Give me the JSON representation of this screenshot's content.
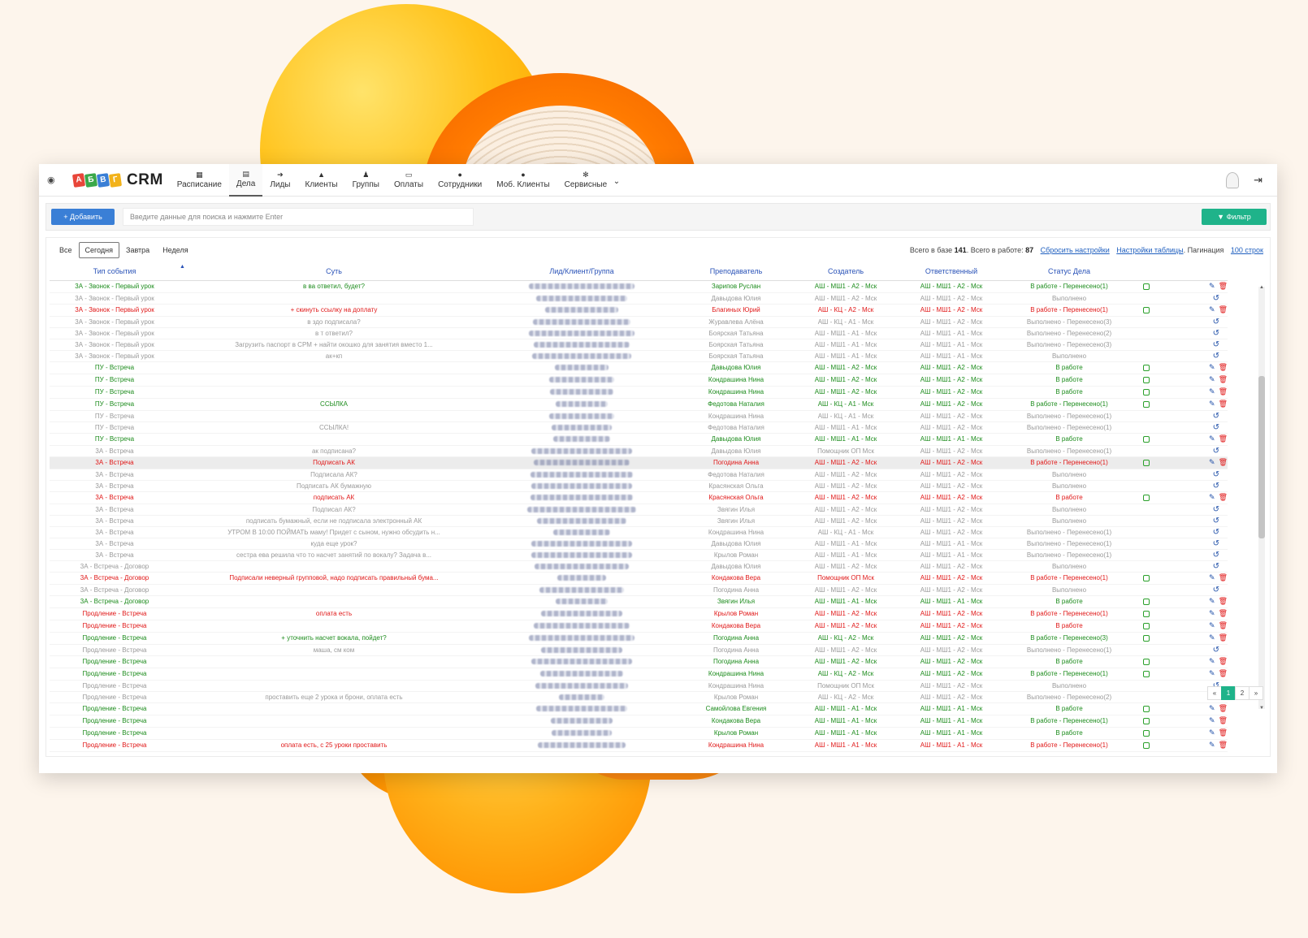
{
  "logo": {
    "text": "CRM"
  },
  "nav": [
    {
      "icon": "calendar-icon",
      "glyph": "▦",
      "label": "Расписание"
    },
    {
      "icon": "calendar-check-icon",
      "glyph": "▤",
      "label": "Дела",
      "active": true
    },
    {
      "icon": "sign-in-icon",
      "glyph": "➔",
      "label": "Лиды"
    },
    {
      "icon": "graduation-cap-icon",
      "glyph": "▲",
      "label": "Клиенты"
    },
    {
      "icon": "users-icon",
      "glyph": "♟",
      "label": "Группы"
    },
    {
      "icon": "credit-card-icon",
      "glyph": "▭",
      "label": "Оплаты"
    },
    {
      "icon": "user-icon",
      "glyph": "●",
      "label": "Сотрудники"
    },
    {
      "icon": "user-icon",
      "glyph": "●",
      "label": "Моб. Клиенты"
    },
    {
      "icon": "gear-icon",
      "glyph": "✻",
      "label": "Сервисные"
    }
  ],
  "toolbar": {
    "add_label": "+ Добавить",
    "search_placeholder": "Введите данные для поиска и нажмите Enter",
    "filter_label": "▼ Фильтр"
  },
  "tabs": [
    "Все",
    "Сегодня",
    "Завтра",
    "Неделя"
  ],
  "stats": {
    "total_prefix": "Всего в базе",
    "total": "141",
    "work_prefix": ". Всего в работе:",
    "work": "87",
    "reset": "Сбросить настройки",
    "table_settings": "Настройки таблицы",
    "pagination_prefix": ". Пагинация",
    "pagination": "100 строк"
  },
  "columns": [
    "Тип события",
    "Суть",
    "Лид/Клиент/Группа",
    "Преподаватель",
    "Создатель",
    "Ответственный",
    "Статус Дела"
  ],
  "rows": [
    {
      "c": "g",
      "type": "3А - Звонок - Первый урок",
      "note": "в ва ответил, будет?",
      "w": 130,
      "teacher": "Зарипов Руслан",
      "creator": "АШ - МШ1 - А2 - Мск",
      "resp": "АШ - МШ1 - А2 - Мск",
      "status": "В работе - Перенесено(1)",
      "act": "edit"
    },
    {
      "c": "x",
      "type": "3А - Звонок - Первый урок",
      "note": "",
      "w": 112,
      "teacher": "Давыдова Юлия",
      "creator": "АШ - МШ1 - А2 - Мск",
      "resp": "АШ - МШ1 - А2 - Мск",
      "status": "Выполнено",
      "act": "undo"
    },
    {
      "c": "r",
      "type": "3А - Звонок - Первый урок",
      "note": "+ скинуть ссылку на доплату",
      "w": 90,
      "teacher": "Благиных Юрий",
      "creator": "АШ - КЦ - А2 - Мск",
      "resp": "АШ - МШ1 - А2 - Мск",
      "status": "В работе - Перенесено(1)",
      "act": "edit"
    },
    {
      "c": "x",
      "type": "3А - Звонок - Первый урок",
      "note": "в здо подписала?",
      "w": 120,
      "teacher": "Журавлева Алёна",
      "creator": "АШ - КЦ - А1 - Мск",
      "resp": "АШ - МШ1 - А2 - Мск",
      "status": "Выполнено - Перенесено(3)",
      "act": "undo"
    },
    {
      "c": "x",
      "type": "3А - Звонок - Первый урок",
      "note": "в т ответил?",
      "w": 130,
      "teacher": "Боярская Татьяна",
      "creator": "АШ - МШ1 - А1 - Мск",
      "resp": "АШ - МШ1 - А1 - Мск",
      "status": "Выполнено - Перенесено(2)",
      "act": "undo"
    },
    {
      "c": "x",
      "type": "3А - Звонок - Первый урок",
      "note": "Загрузить паспорт в СРМ + найти окошко для занятия вместо 1...",
      "w": 118,
      "teacher": "Боярская Татьяна",
      "creator": "АШ - МШ1 - А1 - Мск",
      "resp": "АШ - МШ1 - А1 - Мск",
      "status": "Выполнено - Перенесено(3)",
      "act": "undo"
    },
    {
      "c": "x",
      "type": "3А - Звонок - Первый урок",
      "note": "ак+кп",
      "w": 122,
      "teacher": "Боярская Татьяна",
      "creator": "АШ - МШ1 - А1 - Мск",
      "resp": "АШ - МШ1 - А1 - Мск",
      "status": "Выполнено",
      "act": "undo"
    },
    {
      "c": "g",
      "type": "ПУ - Встреча",
      "note": "",
      "w": 66,
      "teacher": "Давыдова Юлия",
      "creator": "АШ - МШ1 - А2 - Мск",
      "resp": "АШ - МШ1 - А2 - Мск",
      "status": "В работе",
      "act": "edit"
    },
    {
      "c": "g",
      "type": "ПУ - Встреча",
      "note": "",
      "w": 80,
      "teacher": "Кондрашина Нина",
      "creator": "АШ - МШ1 - А2 - Мск",
      "resp": "АШ - МШ1 - А2 - Мск",
      "status": "В работе",
      "act": "edit"
    },
    {
      "c": "g",
      "type": "ПУ - Встреча",
      "note": "",
      "w": 78,
      "teacher": "Кондрашина Нина",
      "creator": "АШ - МШ1 - А2 - Мск",
      "resp": "АШ - МШ1 - А2 - Мск",
      "status": "В работе",
      "act": "edit"
    },
    {
      "c": "g",
      "type": "ПУ - Встреча",
      "note": "ССЫЛКА",
      "w": 64,
      "teacher": "Федотова Наталия",
      "creator": "АШ - КЦ - А1 - Мск",
      "resp": "АШ - МШ1 - А2 - Мск",
      "status": "В работе - Перенесено(1)",
      "act": "edit"
    },
    {
      "c": "x",
      "type": "ПУ - Встреча",
      "note": "",
      "w": 80,
      "teacher": "Кондрашина Нина",
      "creator": "АШ - КЦ - А1 - Мск",
      "resp": "АШ - МШ1 - А2 - Мск",
      "status": "Выполнено - Перенесено(1)",
      "act": "undo"
    },
    {
      "c": "x",
      "type": "ПУ - Встреча",
      "note": "ССЫЛКА!",
      "w": 74,
      "teacher": "Федотова Наталия",
      "creator": "АШ - МШ1 - А1 - Мск",
      "resp": "АШ - МШ1 - А2 - Мск",
      "status": "Выполнено - Перенесено(1)",
      "act": "undo"
    },
    {
      "c": "g",
      "type": "ПУ - Встреча",
      "note": "",
      "w": 70,
      "teacher": "Давыдова Юлия",
      "creator": "АШ - МШ1 - А1 - Мск",
      "resp": "АШ - МШ1 - А1 - Мск",
      "status": "В работе",
      "act": "edit"
    },
    {
      "c": "x",
      "type": "3А - Встреча",
      "note": "ак подписана?",
      "w": 124,
      "teacher": "Давыдова Юлия",
      "creator": "Помощник ОП Мск",
      "resp": "АШ - МШ1 - А2 - Мск",
      "status": "Выполнено - Перенесено(1)",
      "act": "undo"
    },
    {
      "c": "r",
      "type": "3А - Встреча",
      "note": "Подписать АК",
      "w": 118,
      "teacher": "Погодина Анна",
      "creator": "АШ - МШ1 - А2 - Мск",
      "resp": "АШ - МШ1 - А2 - Мск",
      "status": "В работе - Перенесено(1)",
      "act": "edit",
      "hl": true
    },
    {
      "c": "x",
      "type": "3А - Встреча",
      "note": "Подписала АК?",
      "w": 126,
      "teacher": "Федотова Наталия",
      "creator": "АШ - МШ1 - А2 - Мск",
      "resp": "АШ - МШ1 - А2 - Мск",
      "status": "Выполнено",
      "act": "undo"
    },
    {
      "c": "x",
      "type": "3А - Встреча",
      "note": "Подписать АК бумажную",
      "w": 124,
      "teacher": "Красянская Ольга",
      "creator": "АШ - МШ1 - А2 - Мск",
      "resp": "АШ - МШ1 - А2 - Мск",
      "status": "Выполнено",
      "act": "undo"
    },
    {
      "c": "r",
      "type": "3А - Встреча",
      "note": "подписать АК",
      "w": 126,
      "teacher": "Красянская Ольга",
      "creator": "АШ - МШ1 - А2 - Мск",
      "resp": "АШ - МШ1 - А2 - Мск",
      "status": "В работе",
      "act": "edit"
    },
    {
      "c": "x",
      "type": "3А - Встреча",
      "note": "Подписал АК?",
      "w": 134,
      "teacher": "Звягин Илья",
      "creator": "АШ - МШ1 - А2 - Мск",
      "resp": "АШ - МШ1 - А2 - Мск",
      "status": "Выполнено",
      "act": "undo"
    },
    {
      "c": "x",
      "type": "3А - Встреча",
      "note": "подписать бумажный, если не подписала электронный АК",
      "w": 110,
      "teacher": "Звягин Илья",
      "creator": "АШ - МШ1 - А2 - Мск",
      "resp": "АШ - МШ1 - А2 - Мск",
      "status": "Выполнено",
      "act": "undo"
    },
    {
      "c": "x",
      "type": "3А - Встреча",
      "note": "УТРОМ В 10:00 ПОЙМАТЬ маму! Придет с сыном, нужно обсудить н...",
      "w": 70,
      "teacher": "Кондрашина Нина",
      "creator": "АШ - КЦ - А1 - Мск",
      "resp": "АШ - МШ1 - А2 - Мск",
      "status": "Выполнено - Перенесено(1)",
      "act": "undo"
    },
    {
      "c": "x",
      "type": "3А - Встреча",
      "note": "куда еще урок?",
      "w": 124,
      "teacher": "Давыдова Юлия",
      "creator": "АШ - МШ1 - А1 - Мск",
      "resp": "АШ - МШ1 - А1 - Мск",
      "status": "Выполнено - Перенесено(1)",
      "act": "undo"
    },
    {
      "c": "x",
      "type": "3А - Встреча",
      "note": "сестра ева решила что то насчет занятий по вокалу? Задача в...",
      "w": 124,
      "teacher": "Крылов Роман",
      "creator": "АШ - МШ1 - А1 - Мск",
      "resp": "АШ - МШ1 - А1 - Мск",
      "status": "Выполнено - Перенесено(1)",
      "act": "undo"
    },
    {
      "c": "x",
      "type": "3А - Встреча - Договор",
      "note": "",
      "w": 116,
      "teacher": "Давыдова Юлия",
      "creator": "АШ - МШ1 - А2 - Мск",
      "resp": "АШ - МШ1 - А2 - Мск",
      "status": "Выполнено",
      "act": "undo"
    },
    {
      "c": "r",
      "type": "3А - Встреча - Договор",
      "note": "Подписали неверный групповой, надо подписать правильный бума...",
      "w": 60,
      "teacher": "Кондакова Вера",
      "creator": "Помощник ОП Мск",
      "resp": "АШ - МШ1 - А2 - Мск",
      "status": "В работе - Перенесено(1)",
      "act": "edit"
    },
    {
      "c": "x",
      "type": "3А - Встреча - Договор",
      "note": "",
      "w": 104,
      "teacher": "Погодина Анна",
      "creator": "АШ - МШ1 - А2 - Мск",
      "resp": "АШ - МШ1 - А2 - Мск",
      "status": "Выполнено",
      "act": "undo"
    },
    {
      "c": "g",
      "type": "3А - Встреча - Договор",
      "note": "",
      "w": 64,
      "teacher": "Звягин Илья",
      "creator": "АШ - МШ1 - А1 - Мск",
      "resp": "АШ - МШ1 - А1 - Мск",
      "status": "В работе",
      "act": "edit"
    },
    {
      "c": "r",
      "type": "Продление - Встреча",
      "note": "оплата есть",
      "w": 100,
      "teacher": "Крылов Роман",
      "creator": "АШ - МШ1 - А2 - Мск",
      "resp": "АШ - МШ1 - А2 - Мск",
      "status": "В работе - Перенесено(1)",
      "act": "edit"
    },
    {
      "c": "r",
      "type": "Продление - Встреча",
      "note": "",
      "w": 118,
      "teacher": "Кондакова Вера",
      "creator": "АШ - МШ1 - А2 - Мск",
      "resp": "АШ - МШ1 - А2 - Мск",
      "status": "В работе",
      "act": "edit"
    },
    {
      "c": "g",
      "type": "Продление - Встреча",
      "note": "+ уточнить насчет вокала, пойдет?",
      "w": 130,
      "teacher": "Погодина Анна",
      "creator": "АШ - КЦ - А2 - Мск",
      "resp": "АШ - МШ1 - А2 - Мск",
      "status": "В работе - Перенесено(3)",
      "act": "edit"
    },
    {
      "c": "x",
      "type": "Продление - Встреча",
      "note": "маша, см ком",
      "w": 100,
      "teacher": "Погодина Анна",
      "creator": "АШ - МШ1 - А2 - Мск",
      "resp": "АШ - МШ1 - А2 - Мск",
      "status": "Выполнено - Перенесено(1)",
      "act": "undo"
    },
    {
      "c": "g",
      "type": "Продление - Встреча",
      "note": "",
      "w": 124,
      "teacher": "Погодина Анна",
      "creator": "АШ - МШ1 - А2 - Мск",
      "resp": "АШ - МШ1 - А2 - Мск",
      "status": "В работе",
      "act": "edit"
    },
    {
      "c": "g",
      "type": "Продление - Встреча",
      "note": "",
      "w": 102,
      "teacher": "Кондрашина Нина",
      "creator": "АШ - КЦ - А2 - Мск",
      "resp": "АШ - МШ1 - А2 - Мск",
      "status": "В работе - Перенесено(1)",
      "act": "edit"
    },
    {
      "c": "x",
      "type": "Продление - Встреча",
      "note": "",
      "w": 114,
      "teacher": "Кондрашина Нина",
      "creator": "Помощник ОП Мск",
      "resp": "АШ - МШ1 - А2 - Мск",
      "status": "Выполнено",
      "act": "undo"
    },
    {
      "c": "x",
      "type": "Продление - Встреча",
      "note": "проставить еще 2 урока и брони, оплата есть",
      "w": 56,
      "teacher": "Крылов Роман",
      "creator": "АШ - КЦ - А2 - Мск",
      "resp": "АШ - МШ1 - А2 - Мск",
      "status": "Выполнено - Перенесено(2)",
      "act": "undo"
    },
    {
      "c": "g",
      "type": "Продление - Встреча",
      "note": "",
      "w": 112,
      "teacher": "Самойлова Евгения",
      "creator": "АШ - МШ1 - А1 - Мск",
      "resp": "АШ - МШ1 - А1 - Мск",
      "status": "В работе",
      "act": "edit"
    },
    {
      "c": "g",
      "type": "Продление - Встреча",
      "note": "",
      "w": 76,
      "teacher": "Кондакова Вера",
      "creator": "АШ - МШ1 - А1 - Мск",
      "resp": "АШ - МШ1 - А1 - Мск",
      "status": "В работе - Перенесено(1)",
      "act": "edit"
    },
    {
      "c": "g",
      "type": "Продление - Встреча",
      "note": "",
      "w": 74,
      "teacher": "Крылов Роман",
      "creator": "АШ - МШ1 - А1 - Мск",
      "resp": "АШ - МШ1 - А1 - Мск",
      "status": "В работе",
      "act": "edit"
    },
    {
      "c": "r",
      "type": "Продление - Встреча",
      "note": "оплата есть, с 25 уроки проставить",
      "w": 108,
      "teacher": "Кондрашина Нина",
      "creator": "АШ - МШ1 - А1 - Мск",
      "resp": "АШ - МШ1 - А1 - Мск",
      "status": "В работе - Перенесено(1)",
      "act": "edit"
    }
  ],
  "pagination": {
    "prev": "«",
    "pages": [
      "1",
      "2"
    ],
    "current": "1",
    "next": "»"
  },
  "colors": {
    "accent": "#1fb38a",
    "add": "#3a7fd6",
    "green": "#1d8c1d",
    "red": "#e01818",
    "grey": "#9a9a9a"
  }
}
